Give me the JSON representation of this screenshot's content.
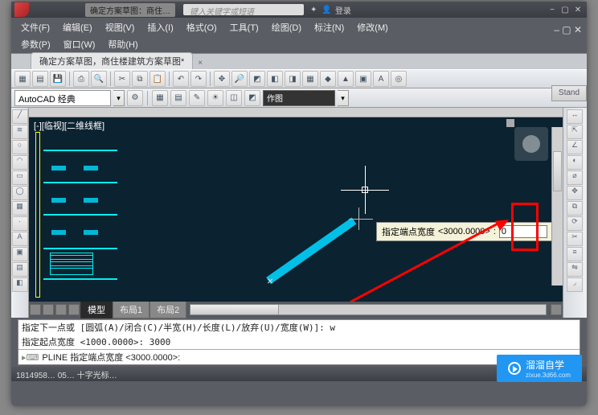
{
  "titlebar": {
    "blurred_title": "确定方案草图：商住…",
    "search_placeholder": "键入关键字或短语",
    "login": "登录"
  },
  "menu": {
    "file": "文件(F)",
    "edit": "编辑(E)",
    "view": "视图(V)",
    "insert": "插入(I)",
    "format": "格式(O)",
    "tool": "工具(T)",
    "draw": "绘图(D)",
    "dim": "标注(N)",
    "modify": "修改(M)",
    "param": "参数(P)",
    "window": "窗口(W)",
    "help": "帮助(H)"
  },
  "tab": {
    "name": "确定方案草图，商住楼建筑方案草图*"
  },
  "workspace": "AutoCAD 经典",
  "layerbox": "作图",
  "view_label": "[-][临视][二维线框]",
  "tooltip": {
    "label": "指定端点宽度",
    "default": "<3000.0000>",
    "value": "0"
  },
  "modeltabs": {
    "model": "模型",
    "layout1": "布局1",
    "layout2": "布局2"
  },
  "cmd": {
    "line1": "指定下一点或 [圆弧(A)/闭合(C)/半宽(H)/长度(L)/放弃(U)/宽度(W)]: w",
    "line2": "指定起点宽度 <1000.0000>: 3000",
    "prompt": "PLINE 指定端点宽度 <3000.0000>:"
  },
  "status": "1814958… 05… 十字光标…",
  "watermark": {
    "big": "溜溜自学",
    "small": "zixue.3d66.com"
  },
  "stand": "Stand"
}
